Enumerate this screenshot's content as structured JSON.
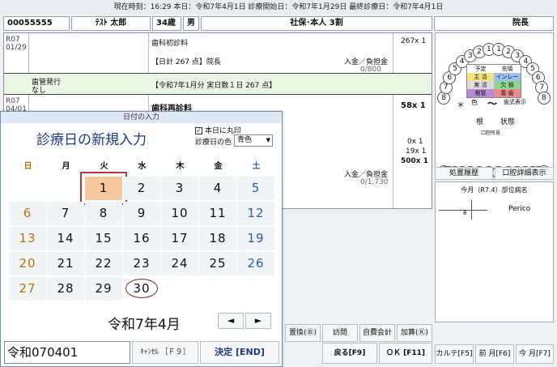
{
  "info_bar": {
    "text": "現在時刻：16:29  本日：令和7年4月1日   診療開始日：令和7年1月29日   最終診療日：令和7年4月1日"
  },
  "patient": {
    "id": "00055555",
    "name": "ﾃｽﾄ 太郎",
    "age": "34歳",
    "sex": "男",
    "insurance": "社保･本人 3割",
    "doctor": "院長"
  },
  "chart": {
    "entry1": {
      "date": "R07",
      "date2": "01/29",
      "item": "歯科初診料",
      "amount": "267x 1",
      "total": "【日計 267 点】院長",
      "pay_label": "入金／負担金",
      "pay_val": "0/800"
    },
    "entry2": {
      "left1": "歯管発行",
      "left2": "なし",
      "text": "【令和7年1月分 実日数１日 267 点】"
    },
    "entry3": {
      "date": "R07",
      "date2": "04/01",
      "item": "歯科再診料",
      "amount": "58x 1",
      "a2": "0x 1",
      "a3": "19x 1",
      "a4": "500x 1",
      "pay_label": "入金／負担金",
      "pay_val": "0/1,730"
    }
  },
  "dialog": {
    "title": "日付の入力",
    "heading": "診療日の新規入力",
    "mark_today": "本日に丸印",
    "color_label": "診療日の色",
    "color_value": "青色",
    "weekdays": [
      "日",
      "月",
      "火",
      "水",
      "木",
      "金",
      "土"
    ],
    "weeks": [
      [
        "",
        "",
        "1",
        "2",
        "3",
        "4",
        "5"
      ],
      [
        "6",
        "7",
        "8",
        "9",
        "10",
        "11",
        "12"
      ],
      [
        "13",
        "14",
        "15",
        "16",
        "17",
        "18",
        "19"
      ],
      [
        "20",
        "21",
        "22",
        "23",
        "24",
        "25",
        "26"
      ],
      [
        "27",
        "28",
        "29",
        "30",
        "",
        "",
        ""
      ]
    ],
    "month_label": "令和7年4月",
    "prev": "◄",
    "next": "►",
    "input_value": "令和070401",
    "cancel": "ｷｬﾝｾﾙ ［Ｆ９］",
    "ok": "決定 [END]",
    "colors": {
      "sun": "#c0700a",
      "sat": "#2b5fb0",
      "selected": "#f6c89c",
      "border": "#b33a3a"
    }
  },
  "bottom": {
    "b1": "置換(Ⓑ)",
    "b2": "訪問",
    "b3": "自費会計",
    "b4": "加算(Ⓚ)",
    "back": "戻る[F9]",
    "okf": "ＯＫ [F11]",
    "karte": "カルテ[F5]",
    "prev_m": "前 月[F6]",
    "this_m": "今 月[F7]"
  },
  "dental": {
    "upper": [
      "8",
      "7",
      "6",
      "5",
      "4",
      "3",
      "2",
      "1",
      "1",
      "2",
      "3",
      "4",
      "5",
      "6",
      "7",
      "8"
    ],
    "labels": {
      "l1": "予定",
      "l2": "充填",
      "l3": "主 活",
      "l4": "インレー",
      "l5": "実 活",
      "l6": "欠 損",
      "l7": "根管",
      "l8": "義 歯"
    },
    "star": "＊",
    "shoku": "色",
    "tilde": "～",
    "shishiki": "歯式表示",
    "ne": "根",
    "jotai": "状態",
    "kosho": "口腔所見",
    "hist": "処置履歴",
    "detail": "口腔詳細表示",
    "month_label": "今月（R7.4）部位病名",
    "tooth8": "8",
    "perico": "Perico"
  }
}
